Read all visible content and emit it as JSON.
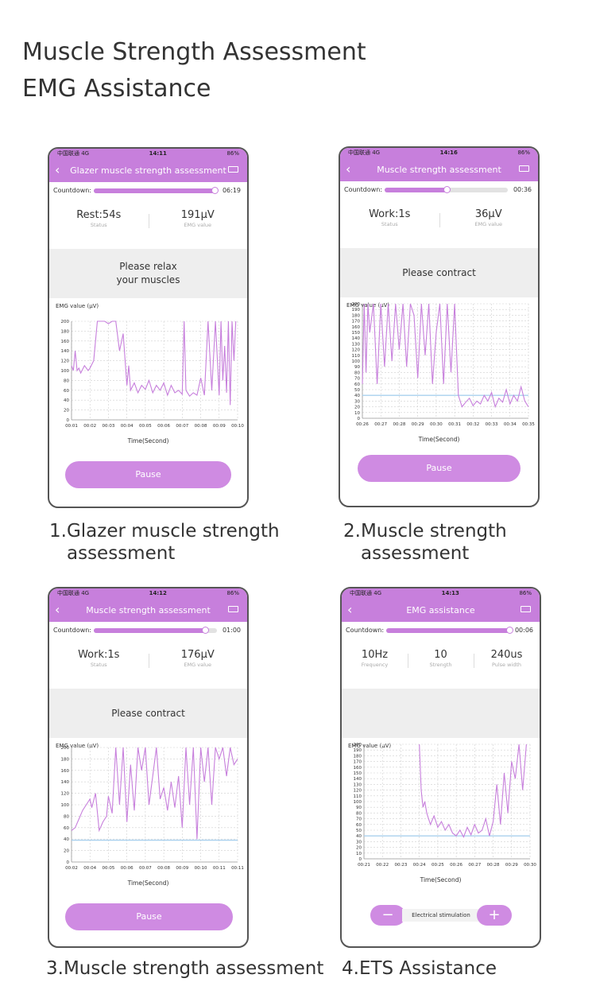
{
  "page": {
    "title_line1": "Muscle Strength Assessment",
    "title_line2": "EMG Assistance"
  },
  "screens": [
    {
      "caption_line1": "1.Glazer muscle strength",
      "caption_line2": "assessment",
      "statusbar": {
        "carrier": "中国联通  4G",
        "time": "14:11",
        "battery": "86%"
      },
      "nav_title": "Glazer muscle strength assessment",
      "countdown": {
        "label": "Countdown:",
        "time": "06:19",
        "progress": 0.98
      },
      "stats": [
        {
          "value": "Rest:54s",
          "label": "Status"
        },
        {
          "value": "191μV",
          "label": "EMG value"
        }
      ],
      "message": [
        "Please relax",
        "your muscles"
      ],
      "emg_label": "EMG value (μV)",
      "button": "Pause"
    },
    {
      "caption_line1": "2.Muscle strength",
      "caption_line2": "assessment",
      "statusbar": {
        "carrier": "中国联通  4G",
        "time": "14:16",
        "battery": "86%"
      },
      "nav_title": "Muscle strength assessment",
      "countdown": {
        "label": "Countdown:",
        "time": "00:36",
        "progress": 0.5
      },
      "stats": [
        {
          "value": "Work:1s",
          "label": "Status"
        },
        {
          "value": "36μV",
          "label": "EMG value"
        }
      ],
      "message": [
        "Please contract"
      ],
      "emg_label": "EMG value (μV)",
      "button": "Pause"
    },
    {
      "caption_line1": "3.Muscle strength assessment",
      "caption_line2": "",
      "statusbar": {
        "carrier": "中国联通  4G",
        "time": "14:12",
        "battery": "86%"
      },
      "nav_title": "Muscle strength assessment",
      "countdown": {
        "label": "Countdown:",
        "time": "01:00",
        "progress": 0.9
      },
      "stats": [
        {
          "value": "Work:1s",
          "label": "Status"
        },
        {
          "value": "176μV",
          "label": "EMG value"
        }
      ],
      "message": [
        "Please contract"
      ],
      "emg_label": "EMG value (μV)",
      "button": "Pause"
    },
    {
      "caption_line1": "4.ETS Assistance",
      "caption_line2": "",
      "statusbar": {
        "carrier": "中国联通  4G",
        "time": "14:13",
        "battery": "86%"
      },
      "nav_title": "EMG assistance",
      "countdown": {
        "label": "Countdown:",
        "time": "00:06",
        "progress": 1.0
      },
      "stats": [
        {
          "value": "10Hz",
          "label": "Frequency"
        },
        {
          "value": "10",
          "label": "Strength"
        },
        {
          "value": "240us",
          "label": "Pulse width"
        }
      ],
      "message": [],
      "emg_label": "EMG value (μV)",
      "stimulation": {
        "minus": "−",
        "label": "Electrical stimulation",
        "plus": "+"
      }
    }
  ],
  "chart_data": [
    {
      "type": "line",
      "xlabel": "Time(Second)",
      "x_ticks": [
        "00:01",
        "00:02",
        "00:03",
        "00:04",
        "00:05",
        "00:06",
        "00:07",
        "00:08",
        "00:09",
        "00:10"
      ],
      "y_ticks": [
        0,
        20,
        40,
        60,
        80,
        100,
        120,
        140,
        160,
        180,
        200
      ],
      "ylim": [
        0,
        200
      ],
      "xlim": [
        1,
        10
      ],
      "grid": true,
      "series": [
        {
          "color": "#c77fdc",
          "x": [
            1,
            1.1,
            1.2,
            1.3,
            1.4,
            1.5,
            1.7,
            1.9,
            2.0,
            2.2,
            2.4,
            2.6,
            2.8,
            3.0,
            3.2,
            3.4,
            3.6,
            3.8,
            4.0,
            4.1,
            4.2,
            4.4,
            4.6,
            4.8,
            5.0,
            5.2,
            5.4,
            5.6,
            5.8,
            6.0,
            6.2,
            6.4,
            6.6,
            6.8,
            7.0,
            7.1,
            7.2,
            7.4,
            7.6,
            7.8,
            8.0,
            8.2,
            8.4,
            8.6,
            8.8,
            9.0,
            9.1,
            9.2,
            9.3,
            9.4,
            9.5,
            9.6,
            9.7,
            9.8,
            9.9
          ],
          "y": [
            110,
            100,
            140,
            100,
            105,
            95,
            110,
            100,
            105,
            120,
            200,
            200,
            200,
            195,
            200,
            200,
            140,
            175,
            70,
            110,
            60,
            75,
            55,
            70,
            62,
            80,
            55,
            70,
            60,
            75,
            50,
            70,
            55,
            60,
            52,
            200,
            60,
            48,
            55,
            50,
            85,
            50,
            200,
            60,
            200,
            50,
            200,
            80,
            150,
            55,
            200,
            30,
            200,
            120,
            200
          ]
        }
      ]
    },
    {
      "type": "line",
      "xlabel": "Time(Second)",
      "x_ticks": [
        "00:26",
        "00:27",
        "00:28",
        "00:29",
        "00:30",
        "00:31",
        "00:32",
        "00:33",
        "00:34",
        "00:35"
      ],
      "y_ticks": [
        0,
        10,
        20,
        30,
        40,
        50,
        60,
        70,
        80,
        90,
        100,
        110,
        120,
        130,
        140,
        150,
        160,
        170,
        180,
        190,
        200
      ],
      "ylim": [
        0,
        200
      ],
      "xlim": [
        26,
        35
      ],
      "grid": true,
      "series": [
        {
          "color": "#c77fdc",
          "x": [
            26.0,
            26.1,
            26.2,
            26.3,
            26.4,
            26.6,
            26.8,
            27.0,
            27.2,
            27.4,
            27.6,
            27.8,
            28.0,
            28.2,
            28.4,
            28.6,
            28.8,
            29.0,
            29.2,
            29.4,
            29.6,
            29.8,
            30.0,
            30.2,
            30.4,
            30.6,
            30.8,
            31.0,
            31.2,
            31.4,
            31.6,
            31.8,
            32.0,
            32.2,
            32.4,
            32.6,
            32.8,
            33.0,
            33.2,
            33.4,
            33.6,
            33.8,
            34.0,
            34.2,
            34.4,
            34.6,
            34.8,
            35.0
          ],
          "y": [
            60,
            200,
            80,
            200,
            150,
            200,
            60,
            200,
            90,
            200,
            100,
            200,
            120,
            200,
            90,
            200,
            180,
            70,
            200,
            110,
            200,
            60,
            150,
            200,
            60,
            200,
            80,
            200,
            40,
            20,
            28,
            35,
            22,
            30,
            25,
            40,
            30,
            45,
            20,
            35,
            28,
            50,
            25,
            40,
            30,
            55,
            30,
            20
          ]
        },
        {
          "color": "#a9d0ee",
          "x": [
            26,
            35
          ],
          "y": [
            40,
            40
          ]
        }
      ]
    },
    {
      "type": "line",
      "xlabel": "Time(Second)",
      "x_ticks": [
        "00:02",
        "00:04",
        "00:05",
        "00:06",
        "00:07",
        "00:08",
        "00:09",
        "00:10",
        "00:11",
        "00:11"
      ],
      "y_ticks": [
        0,
        20,
        40,
        60,
        80,
        100,
        120,
        140,
        160,
        180,
        200
      ],
      "ylim": [
        0,
        200
      ],
      "xlim": [
        0,
        9
      ],
      "grid": true,
      "series": [
        {
          "color": "#c77fdc",
          "x": [
            0,
            0.2,
            0.4,
            0.6,
            0.8,
            1.0,
            1.1,
            1.3,
            1.5,
            1.7,
            1.9,
            2.0,
            2.2,
            2.4,
            2.6,
            2.8,
            3.0,
            3.2,
            3.4,
            3.6,
            3.8,
            4.0,
            4.2,
            4.4,
            4.6,
            4.8,
            5.0,
            5.2,
            5.4,
            5.6,
            5.8,
            6.0,
            6.2,
            6.4,
            6.6,
            6.8,
            7.0,
            7.2,
            7.4,
            7.6,
            7.8,
            8.0,
            8.2,
            8.4,
            8.6,
            8.8,
            9.0
          ],
          "y": [
            55,
            60,
            75,
            90,
            100,
            110,
            95,
            120,
            55,
            70,
            80,
            115,
            85,
            200,
            100,
            200,
            70,
            170,
            90,
            200,
            160,
            200,
            100,
            150,
            200,
            110,
            130,
            90,
            140,
            95,
            150,
            60,
            200,
            100,
            200,
            40,
            200,
            140,
            200,
            100,
            200,
            180,
            200,
            150,
            200,
            170,
            180
          ]
        },
        {
          "color": "#a9d0ee",
          "x": [
            0,
            9
          ],
          "y": [
            38,
            38
          ]
        }
      ]
    },
    {
      "type": "line",
      "xlabel": "Time(Second)",
      "x_ticks": [
        "00:21",
        "00:22",
        "00:23",
        "00:24",
        "00:25",
        "00:26",
        "00:27",
        "00:28",
        "00:29",
        "00:30"
      ],
      "y_ticks": [
        0,
        10,
        20,
        30,
        40,
        50,
        60,
        70,
        80,
        90,
        100,
        110,
        120,
        130,
        140,
        150,
        160,
        170,
        180,
        190,
        200
      ],
      "ylim": [
        0,
        200
      ],
      "xlim": [
        21,
        30
      ],
      "grid": true,
      "series": [
        {
          "color": "#c77fdc",
          "x": [
            24.0,
            24.1,
            24.2,
            24.3,
            24.4,
            24.6,
            24.8,
            25.0,
            25.2,
            25.4,
            25.6,
            25.8,
            26.0,
            26.2,
            26.4,
            26.6,
            26.8,
            27.0,
            27.2,
            27.4,
            27.6,
            27.8,
            28.0,
            28.2,
            28.4,
            28.6,
            28.8,
            29.0,
            29.2,
            29.4,
            29.6,
            29.8
          ],
          "y": [
            200,
            120,
            90,
            100,
            80,
            60,
            75,
            55,
            65,
            50,
            60,
            45,
            40,
            50,
            38,
            55,
            42,
            60,
            45,
            50,
            70,
            40,
            65,
            130,
            60,
            150,
            80,
            170,
            140,
            200,
            120,
            200
          ]
        },
        {
          "color": "#a9d0ee",
          "x": [
            21,
            30
          ],
          "y": [
            40,
            40
          ]
        }
      ]
    }
  ]
}
